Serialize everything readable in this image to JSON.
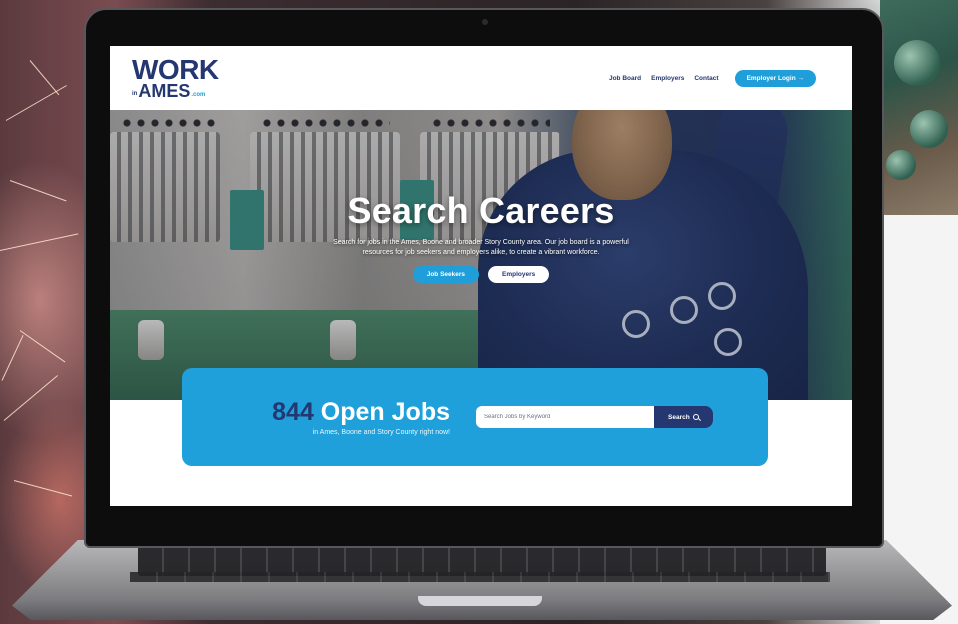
{
  "site": {
    "logo": {
      "word1": "WORK",
      "word2_prefix": "in",
      "word2": "AMES",
      "word2_suffix": ".com"
    }
  },
  "nav": {
    "links": [
      "Job Board",
      "Employers",
      "Contact"
    ],
    "login_label": "Employer Login",
    "login_icon": "arrow-right-icon"
  },
  "hero": {
    "title": "Search Careers",
    "subtitle": "Search for jobs in the Ames, Boone and broader Story County area. Our job board is a powerful resources for job seekers and employers alike, to create a vibrant workforce.",
    "buttons": {
      "seekers": "Job Seekers",
      "employers": "Employers"
    }
  },
  "jobs": {
    "count": "844",
    "label": " Open Jobs",
    "tagline": "in Ames, Boone and Story County right now!",
    "search_placeholder": "Search Jobs by Keyword",
    "search_button": "Search",
    "search_icon": "search-icon"
  },
  "colors": {
    "brand_navy": "#243771",
    "brand_blue": "#1f9ed9",
    "card_blue": "#1fa0da"
  }
}
